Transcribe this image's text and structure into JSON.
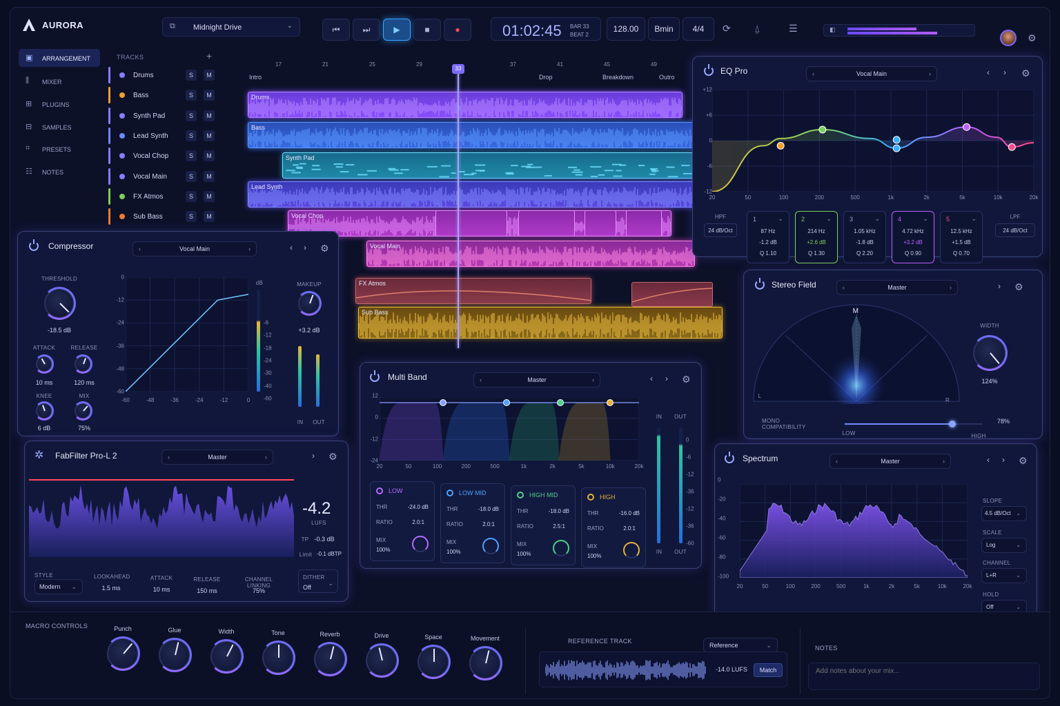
{
  "app": {
    "name": "AURORA",
    "project": "Midnight Drive",
    "time": "01:02:45",
    "bar": "BAR 33",
    "beat": "BEAT 2",
    "tempo": "128.00",
    "key": "Bmin",
    "signature": "4/4"
  },
  "sidebar": [
    "ARRANGEMENT",
    "MIXER",
    "PLUGINS",
    "SAMPLES",
    "PRESETS",
    "NOTES"
  ],
  "tracks_header": "TRACKS",
  "tracks": [
    {
      "name": "Drums",
      "color": "#8b7cff"
    },
    {
      "name": "Bass",
      "color": "#f0a030"
    },
    {
      "name": "Synth Pad",
      "color": "#8b7cff"
    },
    {
      "name": "Lead Synth",
      "color": "#6f88ff"
    },
    {
      "name": "Vocal Chop",
      "color": "#8b7cff"
    },
    {
      "name": "Vocal Main",
      "color": "#8b7cff"
    },
    {
      "name": "FX Atmos",
      "color": "#7ccf5a"
    },
    {
      "name": "Sub Bass",
      "color": "#f07a30"
    }
  ],
  "solo": "S",
  "mute": "M",
  "ruler": [
    "17",
    "21",
    "25",
    "29",
    "33",
    "37",
    "41",
    "45",
    "49",
    "53"
  ],
  "markers": [
    "Intro",
    "Drop",
    "Breakdown",
    "Outro"
  ],
  "clips": [
    "Drums",
    "Bass",
    "Synth Pad",
    "Lead Synth",
    "Vocal Chop",
    "Vocal Main",
    "FX Atmos",
    "Sub Bass"
  ],
  "eq": {
    "title": "EQ Pro",
    "preset": "Vocal Main",
    "yticks": [
      "+12",
      "+6",
      "0",
      "-6",
      "-12"
    ],
    "xticks": [
      "20",
      "50",
      "100",
      "200",
      "500",
      "1k",
      "2k",
      "5k",
      "10k",
      "20k"
    ],
    "hpf": {
      "label": "HPF",
      "slope": "24 dB/Oct"
    },
    "lpf": {
      "label": "LPF",
      "slope": "24 dB/Oct"
    },
    "bands": [
      {
        "n": "1",
        "f": "87 Hz",
        "g": "-1.2 dB",
        "q": "Q 1.10"
      },
      {
        "n": "2",
        "f": "214 Hz",
        "g": "+2.6 dB",
        "q": "Q 1.30"
      },
      {
        "n": "3",
        "f": "1.05 kHz",
        "g": "-1.8 dB",
        "q": "Q 2.20"
      },
      {
        "n": "4",
        "f": "4.72 kHz",
        "g": "+3.2 dB",
        "q": "Q 0.90"
      },
      {
        "n": "5",
        "f": "12.5 kHz",
        "g": "+1.5 dB",
        "q": "Q 0.70"
      }
    ]
  },
  "comp": {
    "title": "Compressor",
    "preset": "Vocal Main",
    "threshold_label": "THRESHOLD",
    "threshold": "-18.5 dB",
    "attack_label": "ATTACK",
    "attack": "10 ms",
    "release_label": "RELEASE",
    "release": "120 ms",
    "knee_label": "KNEE",
    "knee": "6 dB",
    "mix_label": "MIX",
    "mix": "75%",
    "makeup_label": "MAKEUP",
    "makeup": "+3.2 dB",
    "db": "dB",
    "yticks": [
      "0",
      "-12",
      "-24",
      "-36",
      "-48",
      "-60"
    ],
    "xticks": [
      "-60",
      "-48",
      "-36",
      "-24",
      "-12",
      "0"
    ],
    "mticks": [
      "-6",
      "-12",
      "-18",
      "-24",
      "-30",
      "-40",
      "-60"
    ],
    "in": "IN",
    "out": "OUT"
  },
  "stereo": {
    "title": "Stereo Field",
    "preset": "Master",
    "m": "M",
    "l": "L",
    "r": "R",
    "width_label": "WIDTH",
    "width": "124%",
    "mono_label": "MONO COMPATIBILITY",
    "mono": "78%",
    "low": "LOW",
    "high": "HIGH"
  },
  "multiband": {
    "title": "Multi Band",
    "preset": "Master",
    "yticks": [
      "12",
      "0",
      "-12",
      "-24"
    ],
    "xticks": [
      "20",
      "50",
      "100",
      "200",
      "500",
      "1k",
      "2k",
      "5k",
      "10k",
      "20k"
    ],
    "in": "IN",
    "out": "OUT",
    "mticks": [
      "0",
      "-6",
      "-12",
      "-36",
      "-12",
      "-36",
      "-60"
    ],
    "bands": [
      {
        "name": "LOW",
        "thr": "-24.0 dB",
        "ratio": "2.0:1",
        "mix": "100%",
        "color": "#b46cff"
      },
      {
        "name": "LOW MID",
        "thr": "-18.0 dB",
        "ratio": "2.0:1",
        "mix": "100%",
        "color": "#4da3ff"
      },
      {
        "name": "HIGH MID",
        "thr": "-18.0 dB",
        "ratio": "2.5:1",
        "mix": "100%",
        "color": "#4fd08a"
      },
      {
        "name": "HIGH",
        "thr": "-16.0 dB",
        "ratio": "2.0:1",
        "mix": "100%",
        "color": "#e8b23a"
      }
    ],
    "thr": "THR",
    "ratio": "RATIO",
    "mix": "MIX"
  },
  "limiter": {
    "title": "FabFilter Pro-L 2",
    "preset": "Master",
    "lufs": "-4.2",
    "lufs_unit": "LUFS",
    "tp_label": "TP",
    "tp": "-0.3 dB",
    "limit_label": "Limit",
    "limit": "-0.1 dBTP",
    "style_label": "STYLE",
    "style": "Modern",
    "lookahead_label": "LOOKAHEAD",
    "lookahead": "1.5 ms",
    "attack_label": "ATTACK",
    "attack": "10 ms",
    "release_label": "RELEASE",
    "release": "150 ms",
    "link_label": "CHANNEL LINKING",
    "link": "75%",
    "dither_label": "DITHER",
    "dither": "Off"
  },
  "spectrum": {
    "title": "Spectrum",
    "preset": "Master",
    "yticks": [
      "0",
      "-20",
      "-40",
      "-60",
      "-80",
      "-100"
    ],
    "xticks": [
      "20",
      "50",
      "100",
      "200",
      "500",
      "1k",
      "2k",
      "5k",
      "10k",
      "20k"
    ],
    "slope_label": "SLOPE",
    "slope": "4.5 dB/Oct",
    "scale_label": "SCALE",
    "scale": "Log",
    "channel_label": "CHANNEL",
    "channel": "L+R",
    "hold_label": "HOLD",
    "hold": "Off"
  },
  "macro": {
    "title": "MACRO CONTROLS",
    "knobs": [
      "Punch",
      "Glue",
      "Width",
      "Tone",
      "Reverb",
      "Drive",
      "Space",
      "Movement"
    ],
    "levels": [
      0.65,
      0.55,
      0.6,
      0.5,
      0.55,
      0.45,
      0.5,
      0.55
    ]
  },
  "reference": {
    "title": "REFERENCE TRACK",
    "select": "Reference",
    "lufs": "-14.0 LUFS",
    "match": "Match"
  },
  "notes": {
    "title": "NOTES",
    "placeholder": "Add notes about your mix..."
  }
}
